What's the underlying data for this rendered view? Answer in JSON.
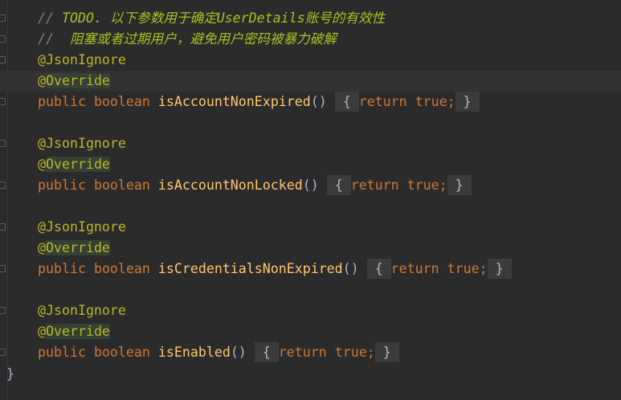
{
  "comment1": {
    "slashes": "//",
    "text": "TODO. 以下参数用于确定UserDetails账号的有效性"
  },
  "comment2": {
    "slashes": "//",
    "text": "阻塞或者过期用户，避免用户密码被暴力破解"
  },
  "annotation_json": "@JsonIgnore",
  "annotation_override_at": "@",
  "annotation_override": "Override",
  "public_kw": "public",
  "boolean_kw": "boolean",
  "return_kw": "return",
  "true_kw": "true;",
  "methods": [
    {
      "name": "isAccountNonExpired"
    },
    {
      "name": "isAccountNonLocked"
    },
    {
      "name": "isCredentialsNonExpired"
    },
    {
      "name": "isEnabled"
    }
  ],
  "parens": "()",
  "open_brace": "{",
  "close_brace": "}",
  "class_close": "}"
}
